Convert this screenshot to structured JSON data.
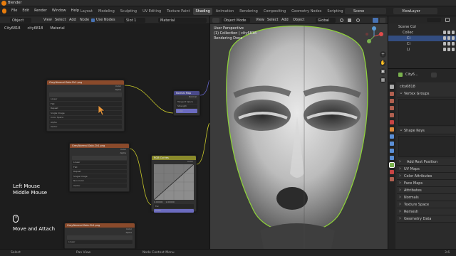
{
  "app": {
    "title": "Blender"
  },
  "menu": [
    "File",
    "Edit",
    "Render",
    "Window",
    "Help"
  ],
  "workspaces": [
    "Layout",
    "Modeling",
    "Sculpting",
    "UV Editing",
    "Texture Paint",
    "Shading",
    "Animation",
    "Rendering",
    "Compositing",
    "Geometry Nodes",
    "Scripting"
  ],
  "active_workspace": "Shading",
  "scene": "Scene",
  "view_layer": "ViewLayer",
  "node_editor": {
    "header": {
      "mode": "Object",
      "view": "View",
      "select": "Select",
      "add": "Add",
      "node": "Node",
      "use_nodes": "Use Nodes",
      "slot": "Slot 1",
      "material": "Material"
    },
    "breadcrumb": [
      "City6818",
      "city6818",
      "Material"
    ],
    "nodes": [
      {
        "title": "Grey.Normal.Gala.Ck1.png",
        "rows": [
          "Linear",
          "Flat",
          "Repeat",
          "Single Image",
          "Color Space",
          "sRGB",
          "Alpha",
          "Straight",
          "Vector"
        ],
        "outputs": [
          "Color",
          "Alpha"
        ]
      },
      {
        "title": "Normal Map",
        "rows": [
          "Tangent Space",
          "Strength",
          "Color"
        ],
        "outputs": [
          "Normal"
        ]
      },
      {
        "title": "Grey.Normal.Gala.Ck1.png",
        "rows": [
          "Linear",
          "Flat",
          "Repeat",
          "Single Image",
          "Color Space",
          "Non-Color",
          "Alpha",
          "Vector"
        ],
        "outputs": [
          "Color",
          "Alpha"
        ]
      },
      {
        "title": "RGB Curves",
        "rows": [
          "Fac",
          "Color"
        ],
        "outputs": [
          "Color"
        ]
      },
      {
        "title": "Grey.Normal.Gala.Ck1.png",
        "rows": [
          "Linear",
          "Flat"
        ],
        "outputs": [
          "Color",
          "Alpha"
        ]
      }
    ],
    "curve_values": [
      "0.00000",
      "1.00000"
    ]
  },
  "overlay_text": {
    "line1": "Left Mouse",
    "line2": "Middle Mouse",
    "line3": "Move and Attach"
  },
  "viewport": {
    "header": {
      "mode": "Object Mode",
      "view": "View",
      "select": "Select",
      "add": "Add",
      "object": "Object",
      "orientation": "Global"
    },
    "info": [
      "User Perspective",
      "(1) Collection | city6818",
      "Rendering Done"
    ]
  },
  "outliner": {
    "rows": [
      {
        "label": "Scene Col",
        "selected": false
      },
      {
        "label": "Collec",
        "selected": false
      },
      {
        "label": "Ci",
        "selected": true
      },
      {
        "label": "Ci",
        "selected": false
      },
      {
        "label": "Li",
        "selected": false
      }
    ]
  },
  "properties": {
    "object": "City6...",
    "mesh": "city6818",
    "panels": [
      {
        "label": "Vertex Groups",
        "open": true
      },
      {
        "label": "Shape Keys",
        "open": true
      },
      {
        "label": "Add Rest Position",
        "open": false
      },
      {
        "label": "UV Maps",
        "open": false
      },
      {
        "label": "Color Attributes",
        "open": false
      },
      {
        "label": "Face Maps",
        "open": false
      },
      {
        "label": "Attributes",
        "open": false
      },
      {
        "label": "Normals",
        "open": false
      },
      {
        "label": "Texture Space",
        "open": false
      },
      {
        "label": "Remesh",
        "open": false
      },
      {
        "label": "Geometry Data",
        "open": false
      }
    ]
  },
  "status": {
    "select": "Select",
    "pan": "Pan View",
    "context": "Node Context Menu",
    "version": "3.6"
  },
  "colors": {
    "accent": "#e87d0d",
    "selection": "#334d80",
    "image_node": "#8a4a2b",
    "vector_node": "#4a4a8a",
    "color_node": "#8a8a2b"
  }
}
